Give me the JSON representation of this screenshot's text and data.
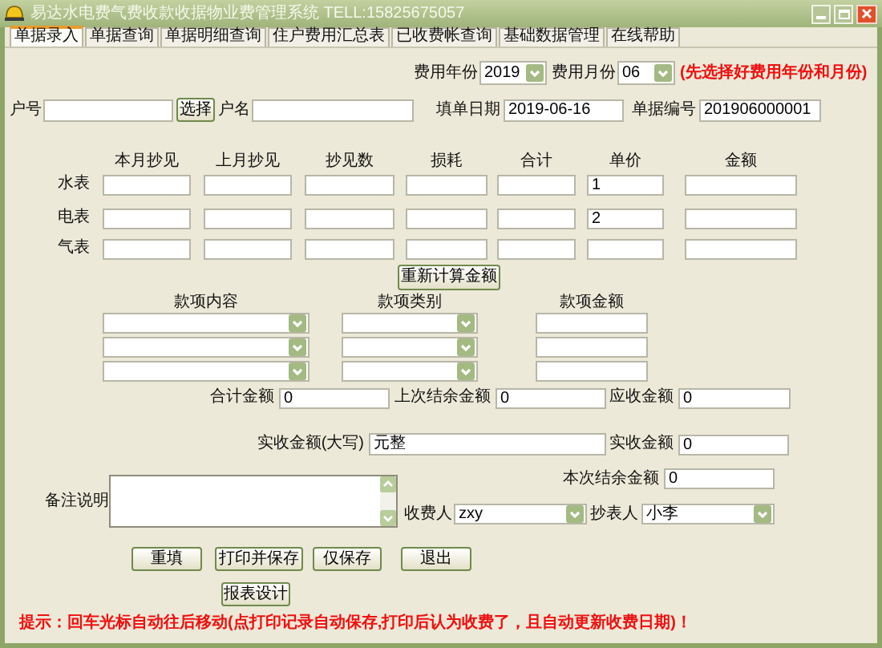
{
  "window": {
    "title": "易达水电费气费收款收据物业费管理系统 TELL:15825675057"
  },
  "tabs": [
    {
      "label": "单据录入",
      "selected": true
    },
    {
      "label": "单据查询",
      "selected": false
    },
    {
      "label": "单据明细查询",
      "selected": false
    },
    {
      "label": "住户费用汇总表",
      "selected": false
    },
    {
      "label": "已收费帐查询",
      "selected": false
    },
    {
      "label": "基础数据管理",
      "selected": false
    },
    {
      "label": "在线帮助",
      "selected": false
    }
  ],
  "fee_year": {
    "label": "费用年份",
    "value": "2019"
  },
  "fee_month": {
    "label": "费用月份",
    "value": "06"
  },
  "period_hint": "(先选择好费用年份和月份)",
  "household_no": {
    "label": "户号"
  },
  "select_button": "选择",
  "household_name": {
    "label": "户名"
  },
  "fill_date": {
    "label": "填单日期",
    "value": "2019-06-16"
  },
  "bill_no": {
    "label": "单据编号",
    "value": "201906000001"
  },
  "meters": {
    "columns": [
      "本月抄见",
      "上月抄见",
      "抄见数",
      "损耗",
      "合计",
      "单价",
      "金额"
    ],
    "rows": [
      {
        "label": "水表",
        "unit_price": "1"
      },
      {
        "label": "电表",
        "unit_price": "2"
      },
      {
        "label": "气表"
      }
    ]
  },
  "recalc_button": "重新计算金额",
  "charge_items": {
    "columns": [
      "款项内容",
      "款项类别",
      "款项金额"
    ]
  },
  "summary": [
    {
      "label": "合计金额",
      "value": "0"
    },
    {
      "label": "上次结余金额",
      "value": "0"
    },
    {
      "label": "应收金额",
      "value": "0"
    }
  ],
  "amount_words": {
    "label": "实收金额(大写)",
    "value": "元整"
  },
  "amount_received": {
    "label": "实收金额",
    "value": "0"
  },
  "balance": {
    "label": "本次结余金额",
    "value": "0"
  },
  "remarks": {
    "label": "备注说明"
  },
  "collector": {
    "label": "收费人",
    "value": "zxy"
  },
  "reader": {
    "label": "抄表人",
    "value": "小李"
  },
  "buttons": [
    "重填",
    "打印并保存",
    "仅保存",
    "退出"
  ],
  "report_button": "报表设计",
  "tip": "提示：回车光标自动往后移动(点打印记录自动保存,打印后认为收费了，且自动更新收费日期)！"
}
